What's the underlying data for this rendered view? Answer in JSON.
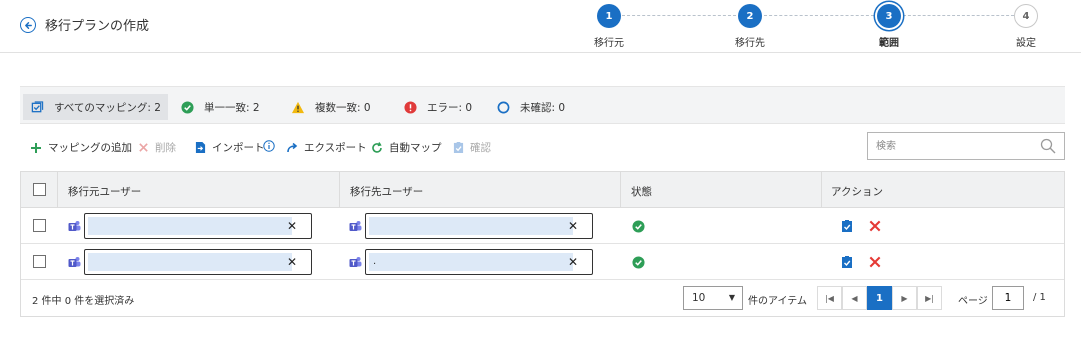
{
  "header": {
    "title": "移行プランの作成",
    "steps": [
      {
        "number": "1",
        "label": "移行元",
        "status": "done"
      },
      {
        "number": "2",
        "label": "移行先",
        "status": "done"
      },
      {
        "number": "3",
        "label": "範囲",
        "status": "current"
      },
      {
        "number": "4",
        "label": "設定",
        "status": "todo"
      }
    ]
  },
  "filters": {
    "all": "すべてのマッピング: 2",
    "single_match": "単一一致: 2",
    "multiple_match": "複数一致: 0",
    "error": "エラー: 0",
    "unconfirmed": "未確認: 0"
  },
  "toolbar": {
    "add_mapping": "マッピングの追加",
    "delete": "削除",
    "import": "インポート",
    "export": "エクスポート",
    "auto_map": "自動マップ",
    "confirm": "確認",
    "search_placeholder": "検索"
  },
  "table": {
    "columns": [
      "移行元ユーザー",
      "移行先ユーザー",
      "状態",
      "アクション"
    ],
    "rows": [
      {
        "source_user": "",
        "target_user": "",
        "status": "ok"
      },
      {
        "source_user": "",
        "target_user": ".",
        "status": "ok"
      }
    ]
  },
  "footer": {
    "selection": "2 件中 0 件を選択済み",
    "page_size": "10",
    "page_size_label": "件のアイテム",
    "current_page": "1",
    "page_label": "ページ",
    "page_input": "1",
    "page_total": "/ 1"
  },
  "colors": {
    "accent": "#1a6fc4",
    "success": "#2e9e57",
    "warning": "#f2b90f",
    "error": "#e03a3a",
    "delete_red": "#e53935"
  }
}
